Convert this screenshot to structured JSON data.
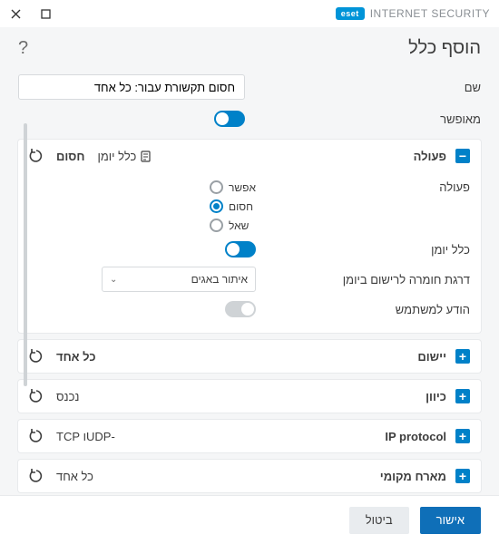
{
  "brand": {
    "badge": "eset",
    "name": "INTERNET SECURITY"
  },
  "page": {
    "title": "הוסף כלל",
    "help": "?"
  },
  "fields": {
    "name_label": "שם",
    "name_value": "חסום תקשורת עבור: כל אחד",
    "enabled_label": "מאופשר"
  },
  "action_panel": {
    "title": "פעולה",
    "summary_action": "חסום",
    "log_label": "כלל יומן",
    "rows": {
      "action_lbl": "פעולה",
      "radios": {
        "allow": "אפשר",
        "block": "חסום",
        "ask": "שאל"
      },
      "log_rule_lbl": "כלל יומן",
      "severity_lbl": "דרגת חומרה לרישום ביומן",
      "severity_val": "איתור באגים",
      "notify_lbl": "הודע למשתמש"
    }
  },
  "panels": {
    "app": {
      "title": "יישום",
      "value": "כל אחד"
    },
    "direction": {
      "title": "כיוון",
      "value": "נכנס"
    },
    "protocol": {
      "title": "IP protocol",
      "value": "-UDPו TCP"
    },
    "local": {
      "title": "מארח מקומי",
      "value": "כל אחד"
    }
  },
  "footer": {
    "ok": "אישור",
    "cancel": "ביטול"
  }
}
